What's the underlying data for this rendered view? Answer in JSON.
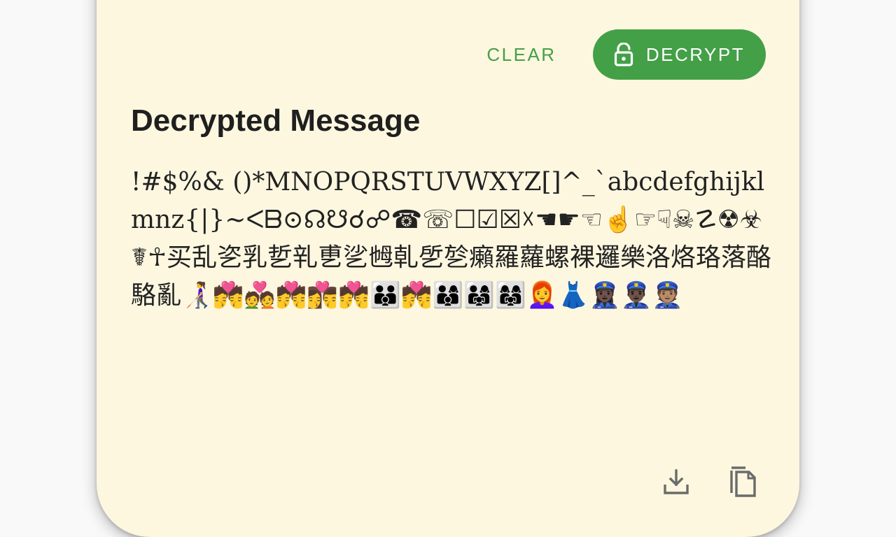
{
  "actions": {
    "clear_label": "CLEAR",
    "decrypt_label": "DECRYPT"
  },
  "result": {
    "title": "Decrypted Message",
    "message": "!#$%& ()*MNOPQRSTUVWXYZ[]^_`abcdefghijklmnz{|}~ᐸᗷ⊙☊☋☌☍☎☏☐☑☒☓☚☛☜☝☞☟☠☡☢☣☤☥买乱乲乳乴乵乶乷乸乹乺乻癩羅蘿螺裸邏樂洛烙珞落酪駱亂👩‍🦯💏💑💏👩‍❤️‍💋‍👨💏👪💏👨‍👩‍👦👨‍👩‍👧👩‍👩‍👧👩‍🦰👗👮🏿‍♀️👮🏿‍♂️👮🏽"
  },
  "icons": {
    "lock": "lock-open-icon",
    "download": "download-icon",
    "copy": "copy-icon"
  },
  "colors": {
    "accent": "#43a047",
    "card_background": "#fdf7e0",
    "page_background": "#f9f9f9",
    "icon_gray": "#6b6b6b"
  }
}
